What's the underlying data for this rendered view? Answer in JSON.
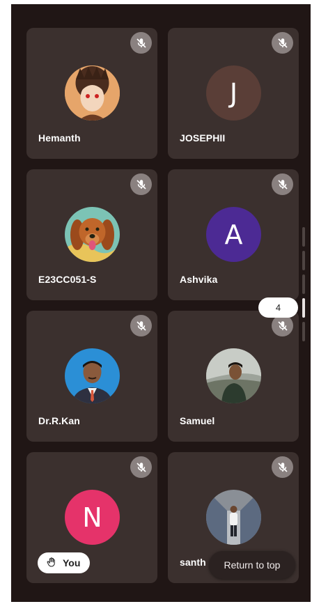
{
  "participants": [
    {
      "name": "Hemanth",
      "initial": "",
      "avatar": "photo-anime-boy"
    },
    {
      "name": "JOSEPHII",
      "initial": "J",
      "avatar": "initial",
      "color": "#5a3e37"
    },
    {
      "name": "E23CC051-S",
      "initial": "",
      "avatar": "photo-dog"
    },
    {
      "name": "Ashvika",
      "initial": "A",
      "avatar": "initial",
      "color": "#4c2a94"
    },
    {
      "name": "Dr.R.Kan",
      "initial": "",
      "avatar": "photo-man-blue"
    },
    {
      "name": "Samuel",
      "initial": "",
      "avatar": "photo-man-outdoor"
    },
    {
      "name": "",
      "initial": "N",
      "avatar": "initial",
      "color": "#e5336a"
    },
    {
      "name": "santh",
      "initial": "",
      "avatar": "photo-man-train"
    }
  ],
  "you_chip": {
    "label": "You",
    "icon": "raised-hand-icon"
  },
  "mute_icon": "mic-off-icon",
  "page_indicator": "4",
  "return_to_top": "Return to top"
}
